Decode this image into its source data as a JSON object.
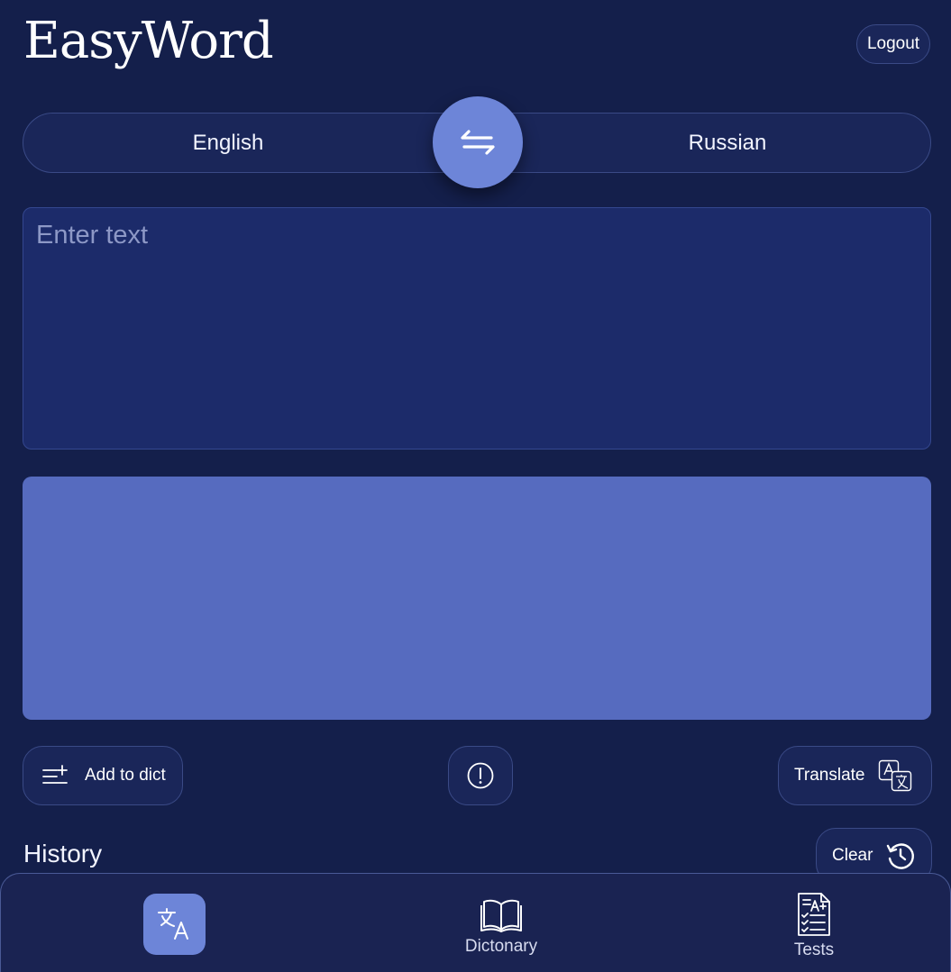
{
  "app": {
    "logo": "EasyWord",
    "logout_label": "Logout"
  },
  "languages": {
    "source": "English",
    "target": "Russian"
  },
  "translator": {
    "input_placeholder": "Enter text",
    "input_value": "",
    "output_value": ""
  },
  "actions": {
    "add_to_dict_label": "Add to dict",
    "translate_label": "Translate"
  },
  "history": {
    "title": "History",
    "clear_label": "Clear"
  },
  "bottom_nav": {
    "items": [
      {
        "label": "",
        "icon": "translate-icon",
        "active": true
      },
      {
        "label": "Dictonary",
        "icon": "book-icon",
        "active": false
      },
      {
        "label": "Tests",
        "icon": "test-document-icon",
        "active": false
      }
    ]
  },
  "colors": {
    "background": "#141f4b",
    "accent": "#6d85d8",
    "input_bg": "#1c2b6a",
    "output_bg": "#566bbf"
  }
}
